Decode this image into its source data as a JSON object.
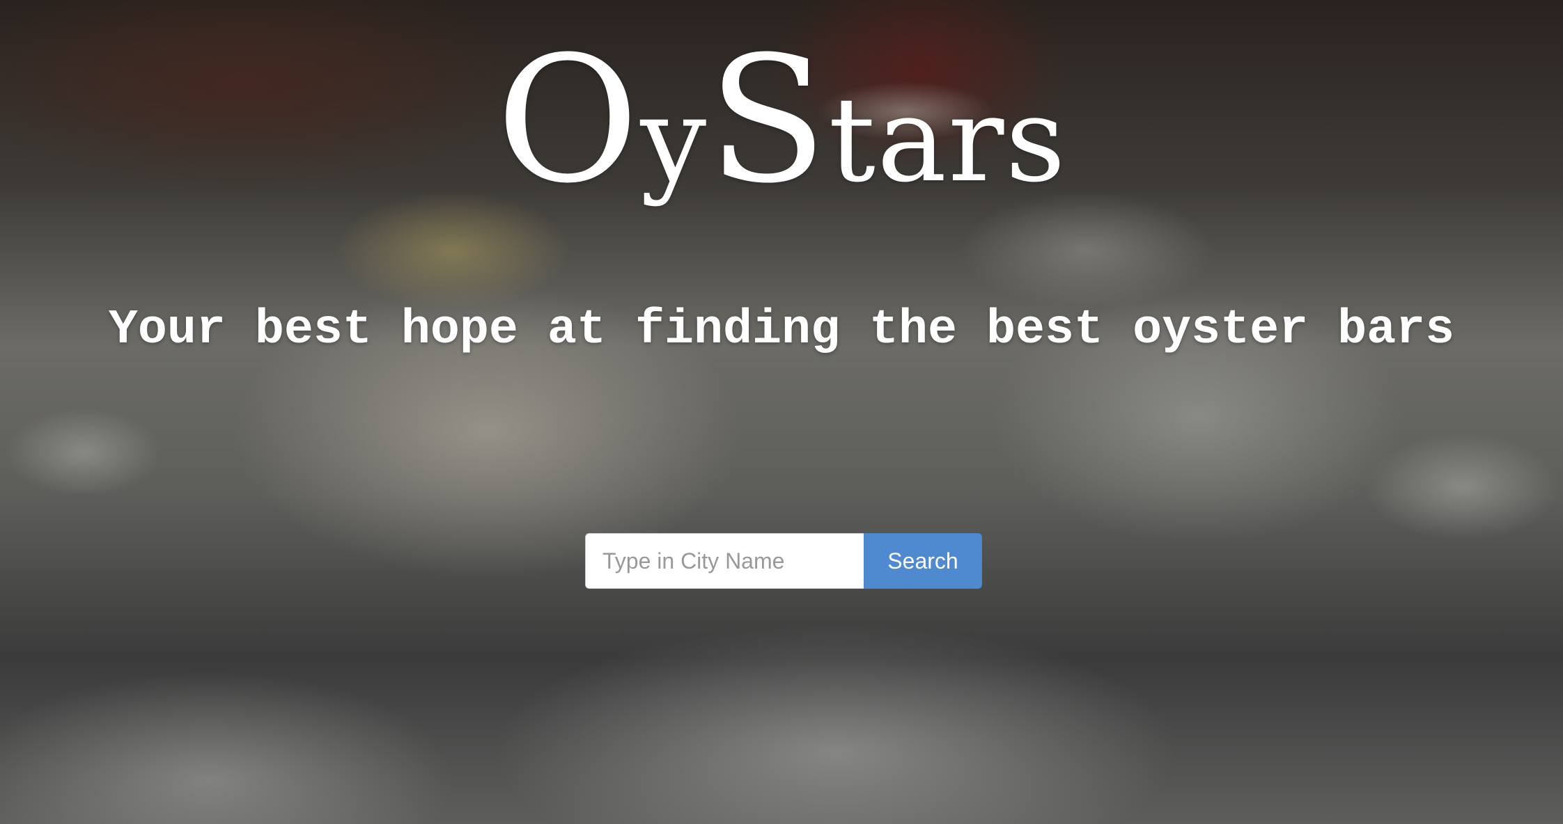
{
  "brand": {
    "part1": "O",
    "part2": "y",
    "part3": "S",
    "part4": "tars"
  },
  "tagline": "Your best hope at finding the best oyster bars",
  "search": {
    "placeholder": "Type in City Name",
    "value": "",
    "button_label": "Search"
  },
  "colors": {
    "search_button": "#4f8ad0",
    "title_text": "#ffffff"
  }
}
